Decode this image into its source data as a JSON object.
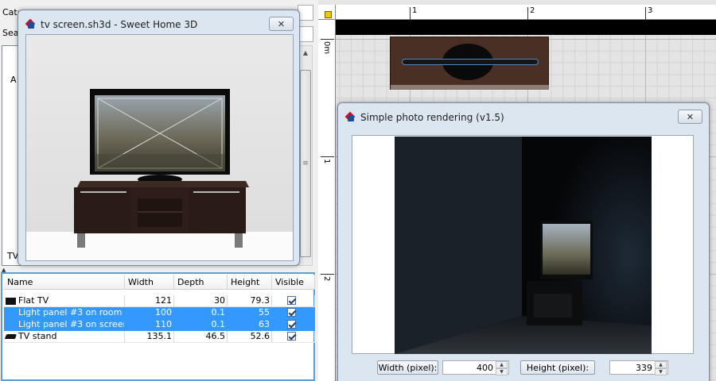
{
  "catalog": {
    "category_label": "Cate",
    "search_label": "Sea",
    "tree_partial_label": "A",
    "tree_item_partial": "TV"
  },
  "furniture_table": {
    "columns": [
      "Name",
      "Width",
      "Depth",
      "Height",
      "Visible"
    ],
    "rows": [
      {
        "name": "Flat TV",
        "width": "121",
        "depth": "30",
        "height": "79.3",
        "visible": true,
        "selected": false,
        "icon": "tv-icon"
      },
      {
        "name": "Light panel #3 on room",
        "width": "100",
        "depth": "0.1",
        "height": "55",
        "visible": true,
        "selected": true,
        "icon": "light-icon"
      },
      {
        "name": "Light panel #3 on screen",
        "width": "110",
        "depth": "0.1",
        "height": "63",
        "visible": true,
        "selected": true,
        "icon": "light-icon"
      },
      {
        "name": "TV stand",
        "width": "135.1",
        "depth": "46.5",
        "height": "52.6",
        "visible": true,
        "selected": false,
        "icon": "tv-stand-icon"
      }
    ]
  },
  "plan": {
    "ruler_h_labels": [
      "1",
      "2",
      "3"
    ],
    "ruler_v_labels": [
      "0m",
      "1",
      "2"
    ]
  },
  "view3d_dialog": {
    "title": "tv screen.sh3d - Sweet Home 3D",
    "close_label": "✕"
  },
  "photo_dialog": {
    "title": "Simple photo rendering (v1.5)",
    "close_label": "✕",
    "width_label": "Width (pixel):",
    "width_value": "400",
    "height_label": "Height (pixel):",
    "height_value": "339"
  },
  "colors": {
    "selection": "#3399ff",
    "wood": "#2e1d18",
    "render_bg": "#050608"
  }
}
